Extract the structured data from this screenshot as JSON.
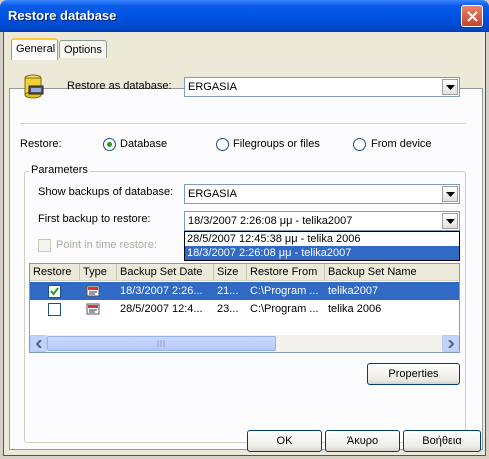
{
  "window": {
    "title": "Restore database"
  },
  "tabs": [
    {
      "label": "General"
    },
    {
      "label": "Options"
    }
  ],
  "restore_as": {
    "label": "Restore as database:",
    "value": "ERGASIA"
  },
  "restore": {
    "label": "Restore:",
    "options": [
      {
        "label": "Database",
        "selected": true
      },
      {
        "label": "Filegroups or files",
        "selected": false
      },
      {
        "label": "From device",
        "selected": false
      }
    ]
  },
  "parameters": {
    "title": "Parameters",
    "show_backups_label": "Show backups of database:",
    "show_backups_value": "ERGASIA",
    "first_backup_label": "First backup to restore:",
    "first_backup_value": "18/3/2007 2:26:08 μμ - telika2007",
    "dropdown_options": [
      {
        "label": "28/5/2007 12:45:38 μμ - telika 2006",
        "selected": false
      },
      {
        "label": "18/3/2007 2:26:08 μμ - telika2007",
        "selected": true
      }
    ],
    "point_in_time_label": "Point in time restore:"
  },
  "grid": {
    "columns": [
      "Restore",
      "Type",
      "Backup Set Date",
      "Size",
      "Restore From",
      "Backup Set Name"
    ],
    "rows": [
      {
        "checked": true,
        "date": "18/3/2007 2:26...",
        "size": "21...",
        "from": "C:\\Program ...",
        "name": "telika2007",
        "selected": true
      },
      {
        "checked": false,
        "date": "28/5/2007 12:4...",
        "size": "23...",
        "from": "C:\\Program ...",
        "name": "telika 2006",
        "selected": false
      }
    ],
    "scroll_position": 0.0
  },
  "buttons": {
    "properties": "Properties",
    "ok": "OK",
    "cancel": "Άκυρο",
    "help": "Βοήθεια"
  },
  "colors": {
    "titlebar": "#0054e3",
    "selection": "#316ac5",
    "radio_dot": "#21a121"
  }
}
